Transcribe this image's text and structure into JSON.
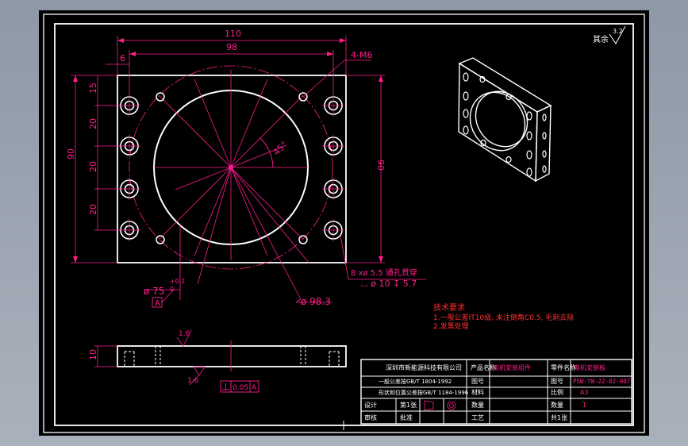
{
  "dimensions": {
    "width_110": "110",
    "width_98": "98",
    "offset_6": "6",
    "hole_callout": "4-M6",
    "dim_15": "15",
    "dim_20_a": "20",
    "dim_20_b": "20",
    "dim_20_c": "20",
    "height_90_left": "90",
    "height_90_right": "90",
    "angle": "45°",
    "bore_dia": "ø 75",
    "bore_tol_upper": "+0.1",
    "bore_tol_lower": "0",
    "datum_a": "A",
    "bolt_circle": "ø 98.3",
    "cbore_line1": "8 xø  5.5 通孔贯穿",
    "cbore_line2": "⌴ ø 10 ↧ 5.7",
    "thickness": "10",
    "roughness_16": "1.6",
    "roughness_16b": "1.6",
    "tolerance_value": "0.05",
    "tolerance_datum": "A",
    "surface_roughness": "3.2",
    "roughness_label": "其余"
  },
  "tech_notes": {
    "title": "技术要求",
    "line1": "1.一般公差IT10级, 未注倒角C0.5, 毛刺去除",
    "line2": "2.发黑处理"
  },
  "title_block": {
    "company": "深圳市新能源科技有限公司",
    "std1": "一般公差按GB/T 1804-1992",
    "std2": "形状和位置公差按GB/T 1184-1996",
    "part_label": "零件名称",
    "part_name": "电机安装板",
    "material_label": "材料",
    "material_value": "",
    "drawing_no_label": "图号",
    "drawing_no": "PSW-YW-22-02-007",
    "scale_label": "比例",
    "scale_value": "A3",
    "qty_label": "数量",
    "qty_value": "1",
    "process_label": "工艺",
    "process_value": "",
    "designer_label": "设计",
    "sheet_label": "第1张",
    "checker_label": "审核",
    "approve_label": "批准",
    "product_label": "产品名称",
    "product_value": "电机安装组件",
    "code_value": "",
    "sheet_total": "共1张"
  },
  "colors": {
    "outline": "#ffffff",
    "dimension": "#ff1e8c",
    "notes": "#ff3030",
    "block_text": "#ffffff",
    "block_accent": "#ff1e8c"
  }
}
